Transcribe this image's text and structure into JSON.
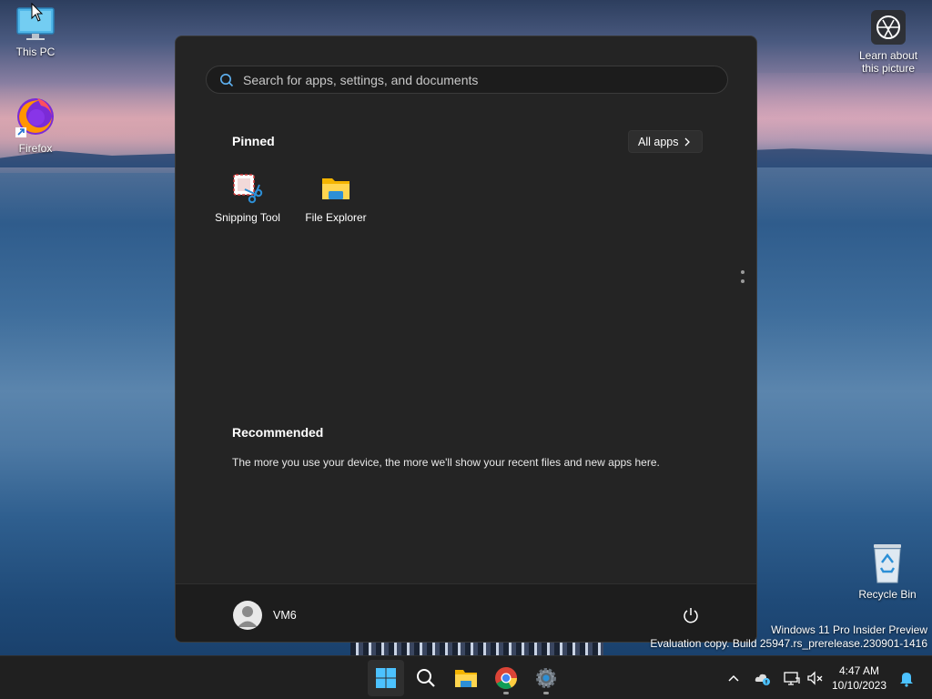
{
  "desktop": {
    "icons": [
      {
        "label": "This PC"
      },
      {
        "label": "Firefox"
      },
      {
        "label": "Recycle Bin"
      }
    ],
    "spotlight": {
      "label": "Learn about this picture"
    },
    "watermark": {
      "line1": "Windows 11 Pro Insider Preview",
      "line2": "Evaluation copy. Build 25947.rs_prerelease.230901-1416"
    }
  },
  "start_menu": {
    "search": {
      "placeholder": "Search for apps, settings, and documents",
      "value": ""
    },
    "pinned": {
      "title": "Pinned",
      "all_apps_label": "All apps",
      "apps": [
        {
          "label": "Snipping Tool"
        },
        {
          "label": "File Explorer"
        }
      ]
    },
    "recommended": {
      "title": "Recommended",
      "text": "The more you use your device, the more we'll show your recent files and new apps here."
    },
    "user": {
      "name": "VM6"
    }
  },
  "taskbar": {
    "apps": [
      "start-icon",
      "search-icon",
      "file-explorer-icon",
      "chrome-icon",
      "settings-icon"
    ],
    "clock": {
      "time": "4:47 AM",
      "date": "10/10/2023"
    }
  },
  "colors": {
    "accent": "#5fb2f2",
    "start_bg": "#242424",
    "taskbar_bg": "#202020"
  }
}
